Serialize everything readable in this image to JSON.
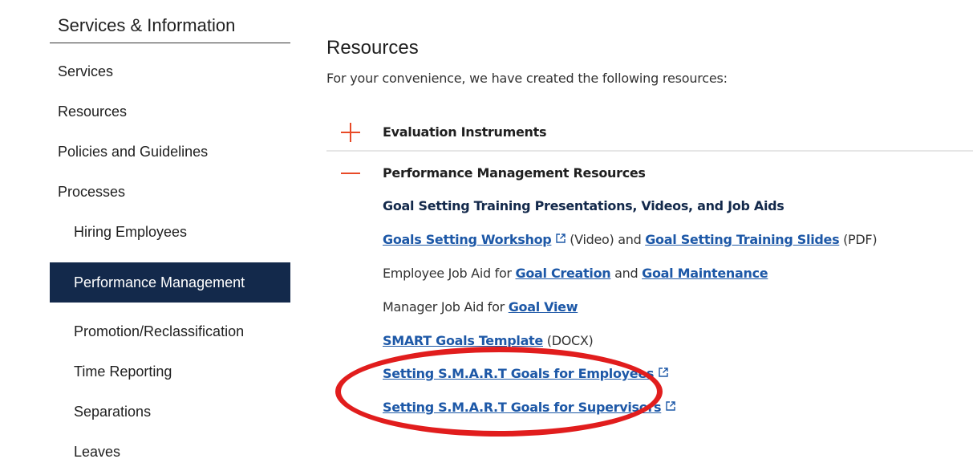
{
  "sidebar": {
    "title": "Services & Information",
    "items": [
      {
        "label": "Services"
      },
      {
        "label": "Resources"
      },
      {
        "label": "Policies and Guidelines"
      },
      {
        "label": "Processes"
      },
      {
        "label": "Hiring Employees"
      },
      {
        "label": "Performance Management"
      },
      {
        "label": "Promotion/Reclassification"
      },
      {
        "label": "Time Reporting"
      },
      {
        "label": "Separations"
      },
      {
        "label": "Leaves"
      }
    ]
  },
  "main": {
    "title": "Resources",
    "intro": "For your convenience, we have created the following resources:",
    "accordion": [
      {
        "heading": "Evaluation Instruments",
        "state": "collapsed"
      },
      {
        "heading": "Performance Management Resources",
        "state": "expanded"
      }
    ],
    "resources": {
      "subheading": "Goal Setting Training  Presentations, Videos, and Job Aids",
      "line1": {
        "link1": "Goals Setting Workshop",
        "text1": " (Video) and ",
        "link2": "Goal Setting Training Slides",
        "text2": " (PDF)"
      },
      "line2": {
        "text1": "Employee Job Aid for ",
        "link1": "Goal Creation",
        "text2": " and ",
        "link2": "Goal Maintenance"
      },
      "line3": {
        "text1": "Manager Job Aid for ",
        "link1": "Goal View"
      },
      "line4": {
        "link1": "SMART Goals Template",
        "text1": " (DOCX)"
      },
      "line5": {
        "link1": "Setting S.M.A.R.T Goals for Employees"
      },
      "line6": {
        "link1": "Setting S.M.A.R.T Goals for Supervisors"
      }
    }
  },
  "colors": {
    "active_bg": "#13294b",
    "accent": "#e84a27",
    "link": "#1d58a7",
    "highlight_circle": "#e11d1d"
  },
  "icons": [
    "plus-icon",
    "minus-icon",
    "external-link-icon"
  ]
}
